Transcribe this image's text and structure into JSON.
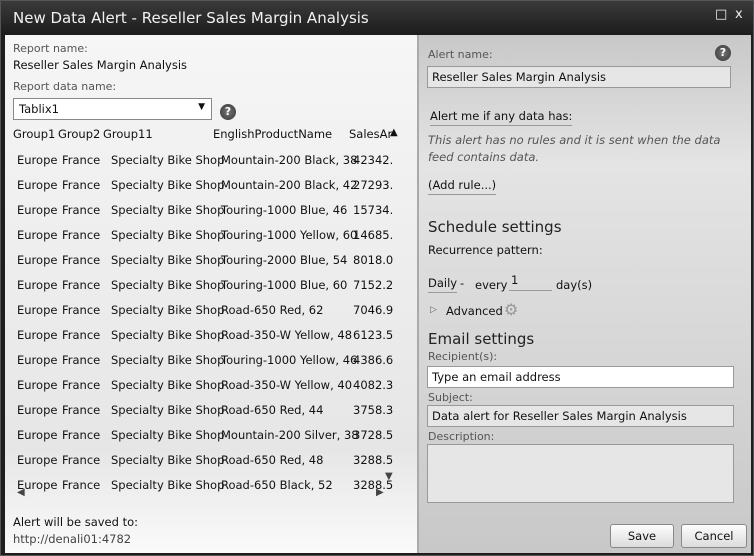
{
  "window": {
    "title": "New Data Alert - Reseller Sales Margin Analysis",
    "maximize_icon": "□",
    "close_icon": "x"
  },
  "left": {
    "report_name_label": "Report name:",
    "report_name": "Reseller Sales Margin Analysis",
    "report_data_label": "Report data name:",
    "report_data_value": "Tablix1",
    "columns": [
      "Group1",
      "Group2",
      "Group11",
      "EnglishProductName",
      "SalesAr"
    ],
    "rows": [
      [
        "Europe",
        "France",
        "Specialty Bike Shop",
        "Mountain-200 Black, 38",
        "42342."
      ],
      [
        "Europe",
        "France",
        "Specialty Bike Shop",
        "Mountain-200 Black, 42",
        "27293."
      ],
      [
        "Europe",
        "France",
        "Specialty Bike Shop",
        "Touring-1000 Blue, 46",
        "15734."
      ],
      [
        "Europe",
        "France",
        "Specialty Bike Shop",
        "Touring-1000 Yellow, 60",
        "14685."
      ],
      [
        "Europe",
        "France",
        "Specialty Bike Shop",
        "Touring-2000 Blue, 54",
        "8018.0"
      ],
      [
        "Europe",
        "France",
        "Specialty Bike Shop",
        "Touring-1000 Blue, 60",
        "7152.2"
      ],
      [
        "Europe",
        "France",
        "Specialty Bike Shop",
        "Road-650 Red, 62",
        "7046.9"
      ],
      [
        "Europe",
        "France",
        "Specialty Bike Shop",
        "Road-350-W Yellow, 48",
        "6123.5"
      ],
      [
        "Europe",
        "France",
        "Specialty Bike Shop",
        "Touring-1000 Yellow, 46",
        "4386.6"
      ],
      [
        "Europe",
        "France",
        "Specialty Bike Shop",
        "Road-350-W Yellow, 40",
        "4082.3"
      ],
      [
        "Europe",
        "France",
        "Specialty Bike Shop",
        "Road-650 Red, 44",
        "3758.3"
      ],
      [
        "Europe",
        "France",
        "Specialty Bike Shop",
        "Mountain-200 Silver, 38",
        "3728.5"
      ],
      [
        "Europe",
        "France",
        "Specialty Bike Shop",
        "Road-650 Red, 48",
        "3288.5"
      ],
      [
        "Europe",
        "France",
        "Specialty Bike Shop",
        "Road-650 Black, 52",
        "3288.5"
      ]
    ],
    "saved_label": "Alert will be saved to:",
    "saved_url": "http://denali01:4782"
  },
  "right": {
    "alert_name_label": "Alert name:",
    "alert_name": "Reseller Sales Margin Analysis",
    "rules_link": "Alert me if any data has:",
    "rules_note": "This alert has no rules and it is sent when the data feed contains data.",
    "add_rule": "(Add rule...)",
    "schedule_heading": "Schedule settings",
    "recurrence_label": "Recurrence pattern:",
    "recurrence": "Daily",
    "dash": "-",
    "every": "every",
    "every_value": "1",
    "unit": "day(s)",
    "advanced": "Advanced",
    "email_heading": "Email settings",
    "recipients_label": "Recipient(s):",
    "recipients_placeholder": "Type an email address",
    "subject_label": "Subject:",
    "subject": "Data alert for Reseller Sales Margin Analysis",
    "description_label": "Description:",
    "description": "",
    "save": "Save",
    "cancel": "Cancel"
  }
}
